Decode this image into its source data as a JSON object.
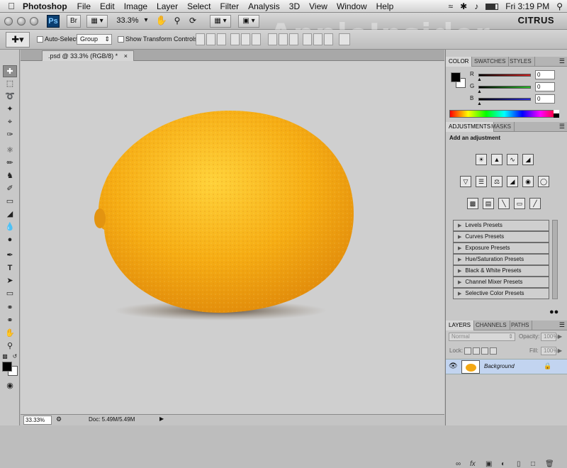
{
  "menubar": {
    "app_name": "Photoshop",
    "menus": [
      "File",
      "Edit",
      "Image",
      "Layer",
      "Select",
      "Filter",
      "Analysis",
      "3D",
      "View",
      "Window",
      "Help"
    ],
    "clock": "Fri 3:19 PM"
  },
  "appbar": {
    "ps_label": "Ps",
    "br_label": "Br",
    "zoom": "33.3%",
    "workspace": "CITRUS",
    "watermark": "AppleInsider"
  },
  "options": {
    "auto_select_label": "Auto-Select:",
    "auto_select_value": "Group",
    "transform_label": "Show Transform Controls"
  },
  "document": {
    "tab_title": ".psd @ 33.3% (RGB/8) *",
    "zoom_field": "33.33%",
    "doc_info": "Doc: 5.49M/5.49M"
  },
  "color_panel": {
    "tabs": [
      "COLOR",
      "SWATCHES",
      "STYLES"
    ],
    "channels": [
      {
        "label": "R",
        "value": "0",
        "color": "#d32020"
      },
      {
        "label": "G",
        "value": "0",
        "color": "#29c229"
      },
      {
        "label": "B",
        "value": "0",
        "color": "#2a2ae0"
      }
    ]
  },
  "adjustments_panel": {
    "tabs": [
      "ADJUSTMENTS",
      "MASKS"
    ],
    "heading": "Add an adjustment",
    "presets": [
      "Levels Presets",
      "Curves Presets",
      "Exposure Presets",
      "Hue/Saturation Presets",
      "Black & White Presets",
      "Channel Mixer Presets",
      "Selective Color Presets"
    ]
  },
  "layers_panel": {
    "tabs": [
      "LAYERS",
      "CHANNELS",
      "PATHS"
    ],
    "blend_mode": "Normal",
    "opacity_label": "Opacity:",
    "opacity_value": "100%",
    "lock_label": "Lock:",
    "fill_label": "Fill:",
    "fill_value": "100%",
    "layer_name": "Background"
  }
}
